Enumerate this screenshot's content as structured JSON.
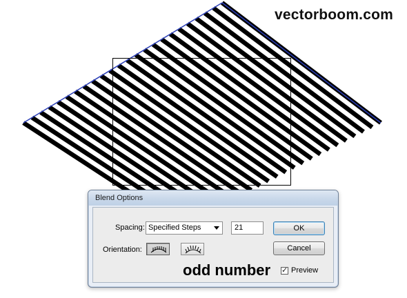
{
  "watermark": "vectorboom.com",
  "artwork": {
    "stripe_count": 21,
    "stripe_color": "#000000",
    "edge_color": "#2b3fb8"
  },
  "dialog": {
    "title": "Blend Options",
    "spacing_label": "Spacing:",
    "spacing_value": "Specified Steps",
    "steps_value": "21",
    "orientation_label": "Orientation:",
    "ok_label": "OK",
    "cancel_label": "Cancel",
    "preview_label": "Preview",
    "preview_checked": true
  },
  "annotation": {
    "text": "odd number",
    "arrow_color": "#e0141c"
  },
  "icons": {
    "dropdown": "chevron-down-icon",
    "align_page": "align-to-page-icon",
    "align_path": "align-to-path-icon",
    "check": "checkmark-icon"
  }
}
